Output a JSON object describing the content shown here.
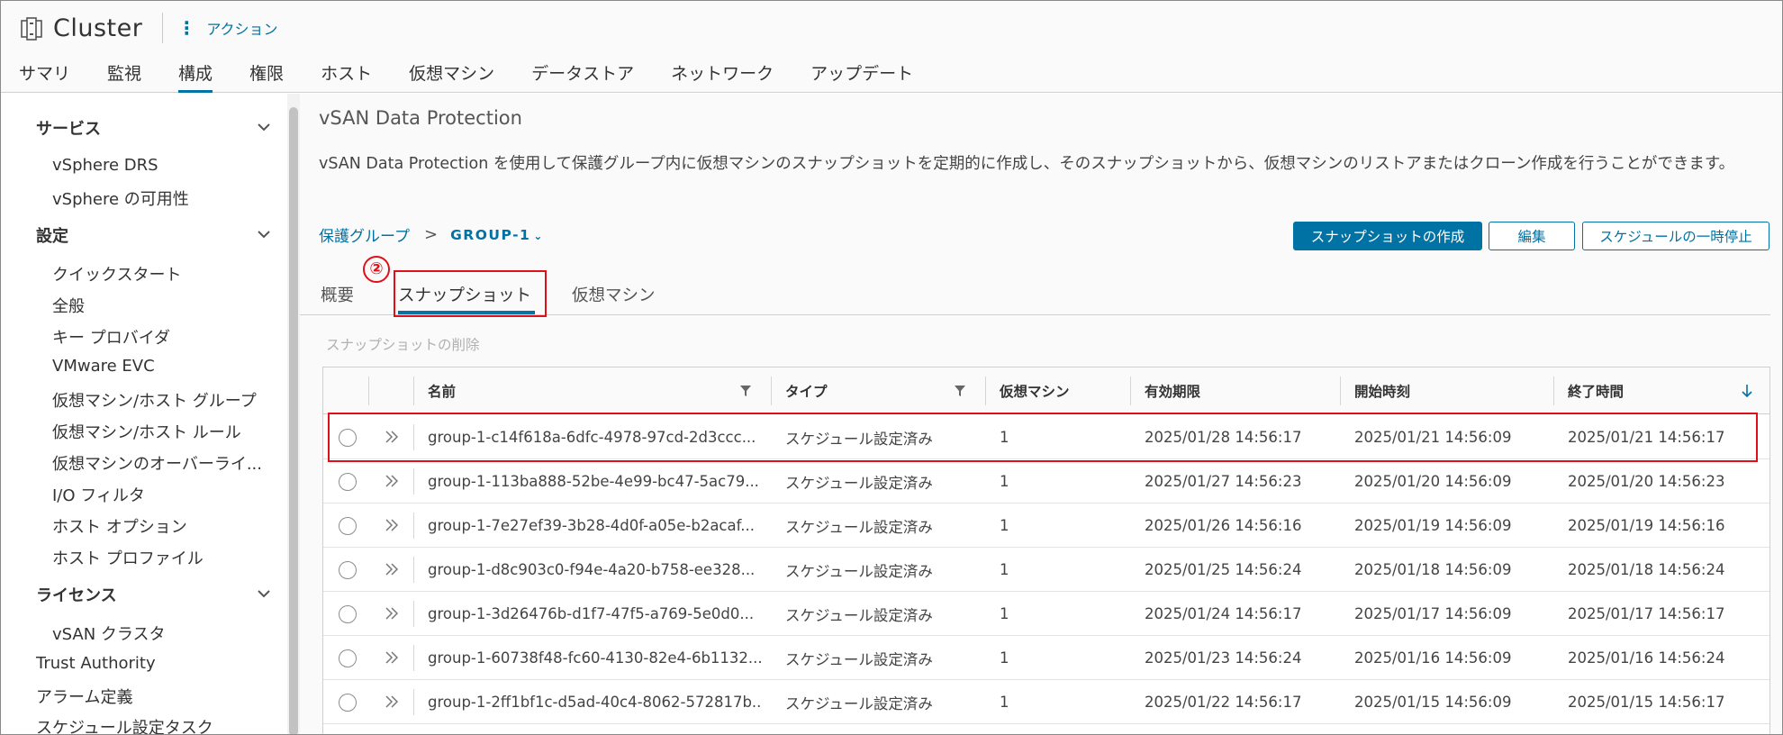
{
  "header": {
    "title": "Cluster",
    "actions_label": "アクション",
    "tabs": [
      "サマリ",
      "監視",
      "構成",
      "権限",
      "ホスト",
      "仮想マシン",
      "データストア",
      "ネットワーク",
      "アップデート"
    ],
    "active_tab": "構成"
  },
  "sidebar": {
    "services": {
      "label": "サービス",
      "items": [
        "vSphere DRS",
        "vSphere の可用性"
      ]
    },
    "settings": {
      "label": "設定",
      "items": [
        "クイックスタート",
        "全般",
        "キー プロバイダ",
        "VMware EVC",
        "仮想マシン/ホスト グループ",
        "仮想マシン/ホスト ルール",
        "仮想マシンのオーバーライ...",
        "I/O フィルタ",
        "ホスト オプション",
        "ホスト プロファイル"
      ]
    },
    "license": {
      "label": "ライセンス",
      "items": [
        "vSAN クラスタ"
      ]
    },
    "bottom_items": [
      "Trust Authority",
      "アラーム定義",
      "スケジュール設定タスク"
    ]
  },
  "content": {
    "title": "vSAN Data Protection",
    "description": "vSAN Data Protection を使用して保護グループ内に仮想マシンのスナップショットを定期的に作成し、そのスナップショットから、仮想マシンのリストアまたはクローン作成を行うことができます。",
    "breadcrumb": {
      "parent": "保護グループ",
      "current": "GROUP-1"
    },
    "buttons": {
      "create": "スナップショットの作成",
      "edit": "編集",
      "pause": "スケジュールの一時停止"
    },
    "sub_tabs": [
      "概要",
      "スナップショット",
      "仮想マシン"
    ],
    "active_sub_tab": "スナップショット",
    "annotation_number": "②",
    "delete_label": "スナップショットの削除"
  },
  "grid": {
    "columns": [
      "名前",
      "タイプ",
      "仮想マシン",
      "有効期限",
      "開始時刻",
      "終了時間"
    ],
    "rows": [
      {
        "name": "group-1-c14f618a-6dfc-4978-97cd-2d3ccc...",
        "type": "スケジュール設定済み",
        "vms": "1",
        "expires": "2025/01/28 14:56:17",
        "start": "2025/01/21 14:56:09",
        "end": "2025/01/21 14:56:17"
      },
      {
        "name": "group-1-113ba888-52be-4e99-bc47-5ac79...",
        "type": "スケジュール設定済み",
        "vms": "1",
        "expires": "2025/01/27 14:56:23",
        "start": "2025/01/20 14:56:09",
        "end": "2025/01/20 14:56:23"
      },
      {
        "name": "group-1-7e27ef39-3b28-4d0f-a05e-b2acaf...",
        "type": "スケジュール設定済み",
        "vms": "1",
        "expires": "2025/01/26 14:56:16",
        "start": "2025/01/19 14:56:09",
        "end": "2025/01/19 14:56:16"
      },
      {
        "name": "group-1-d8c903c0-f94e-4a20-b758-ee328...",
        "type": "スケジュール設定済み",
        "vms": "1",
        "expires": "2025/01/25 14:56:24",
        "start": "2025/01/18 14:56:09",
        "end": "2025/01/18 14:56:24"
      },
      {
        "name": "group-1-3d26476b-d1f7-47f5-a769-5e0d0...",
        "type": "スケジュール設定済み",
        "vms": "1",
        "expires": "2025/01/24 14:56:17",
        "start": "2025/01/17 14:56:09",
        "end": "2025/01/17 14:56:17"
      },
      {
        "name": "group-1-60738f48-fc60-4130-82e4-6b1132...",
        "type": "スケジュール設定済み",
        "vms": "1",
        "expires": "2025/01/23 14:56:24",
        "start": "2025/01/16 14:56:09",
        "end": "2025/01/16 14:56:24"
      },
      {
        "name": "group-1-2ff1bf1c-d5ad-40c4-8062-572817b...",
        "type": "スケジュール設定済み",
        "vms": "1",
        "expires": "2025/01/22 14:56:17",
        "start": "2025/01/15 14:56:09",
        "end": "2025/01/15 14:56:17"
      }
    ]
  },
  "colors": {
    "accent": "#0072a3",
    "annotation": "#e0101a"
  },
  "icons": {
    "cluster": "cluster-icon",
    "actions": "kebab-icon",
    "chevron": "chevron-down-icon",
    "filter": "filter-icon",
    "sort": "sort-down-arrow-icon",
    "expand": "double-chevron-right-icon"
  }
}
